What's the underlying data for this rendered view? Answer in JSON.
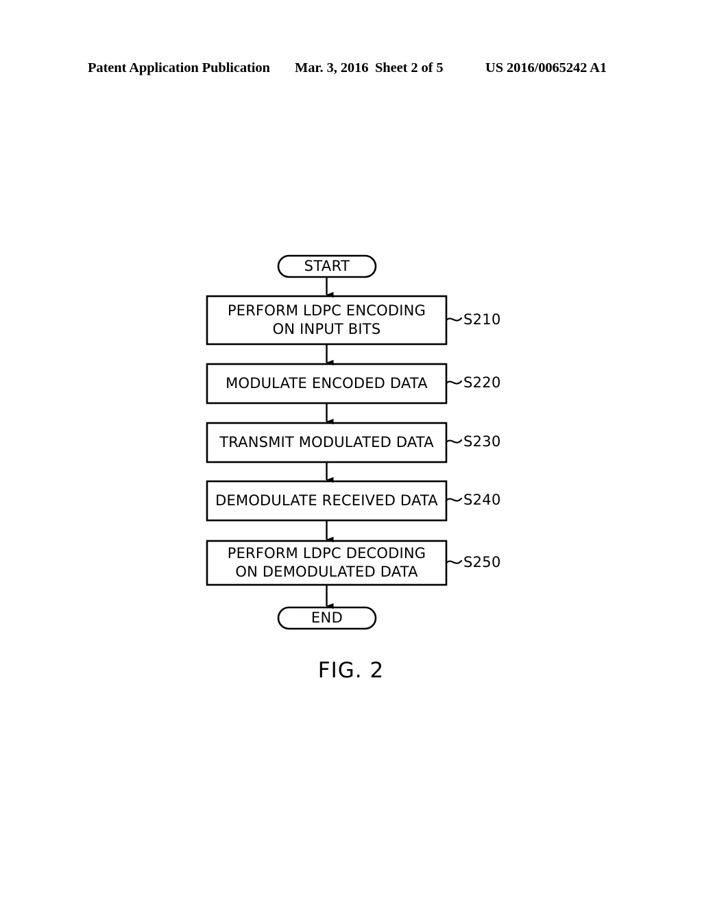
{
  "header": {
    "title": "Patent Application Publication",
    "date": "Mar. 3, 2016",
    "sheet": "Sheet 2 of 5",
    "publication_number": "US 2016/0065242 A1"
  },
  "figure": {
    "caption": "FIG. 2"
  },
  "flowchart": {
    "start": {
      "label": "START"
    },
    "end": {
      "label": "END"
    },
    "steps": [
      {
        "line1": "PERFORM LDPC ENCODING",
        "line2": "ON INPUT BITS",
        "ref": "S210"
      },
      {
        "line1": "MODULATE ENCODED DATA",
        "line2": "",
        "ref": "S220"
      },
      {
        "line1": "TRANSMIT MODULATED DATA",
        "line2": "",
        "ref": "S230"
      },
      {
        "line1": "DEMODULATE RECEIVED DATA",
        "line2": "",
        "ref": "S240"
      },
      {
        "line1": "PERFORM LDPC DECODING",
        "line2": "ON DEMODULATED DATA",
        "ref": "S250"
      }
    ]
  },
  "colors": {
    "ink": "#000000",
    "paper": "#ffffff"
  }
}
